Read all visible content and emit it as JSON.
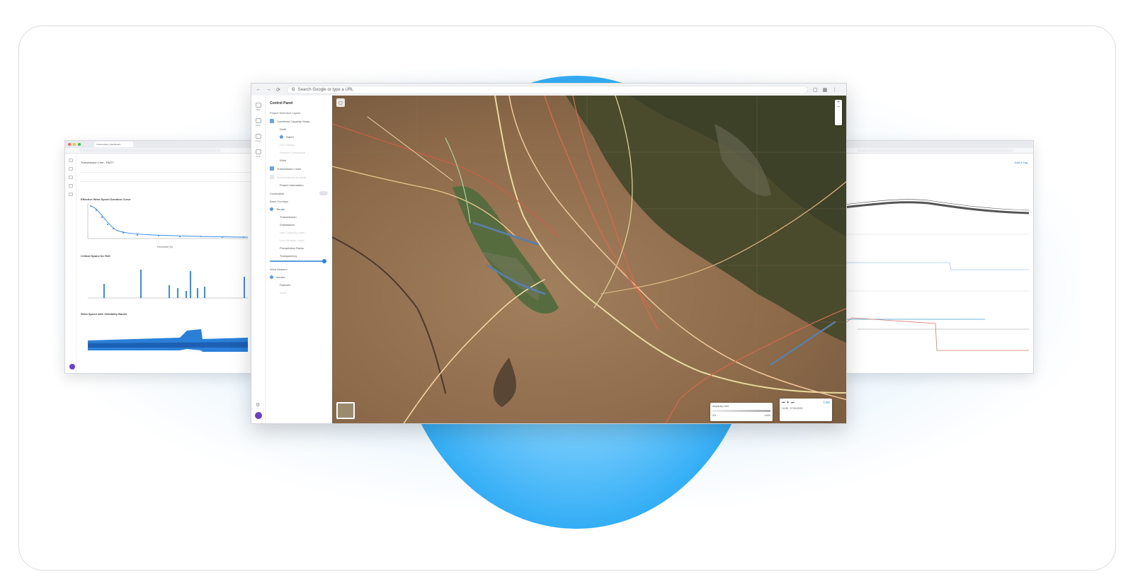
{
  "main_window": {
    "url_placeholder": "Search Google or type a URL",
    "nav": {
      "back": "←",
      "forward": "→",
      "reload": "⟳"
    },
    "control_panel": {
      "title": "Control Panel",
      "section_project_layers": "Project Selection Layers",
      "items": [
        {
          "label": "Combined Capacity Study",
          "kind": "checkbox",
          "checked": true
        },
        {
          "label": "Draft",
          "kind": "sub"
        },
        {
          "label": "Rated",
          "kind": "sub"
        },
        {
          "label": "Line Rating",
          "kind": "sub-faint"
        },
        {
          "label": "Sample Comparison",
          "kind": "sub-faint"
        },
        {
          "label": "Wind",
          "kind": "sub"
        },
        {
          "label": "Transmission Lines",
          "kind": "checkbox",
          "checked": true
        },
        {
          "label": "Environmental Analysis",
          "kind": "checkbox-faint"
        },
        {
          "label": "Project Information",
          "kind": "plain"
        }
      ],
      "toggle_label": "Constraints",
      "section_base_overlays": "Base Overlays",
      "overlays": [
        {
          "label": "Terrain",
          "kind": "radio"
        },
        {
          "label": "Transmission",
          "kind": "plain"
        },
        {
          "label": "Substations",
          "kind": "plain"
        },
        {
          "label": "Line Capacity Layer",
          "kind": "faint"
        },
        {
          "label": "Line Weather Layer",
          "kind": "faint"
        },
        {
          "label": "Precipitation Radar",
          "kind": "plain"
        }
      ],
      "slider_label": "Transparency",
      "slider_value": 0.9,
      "section_wind_markers": "Wind Markers",
      "wind": [
        {
          "label": "Arrows",
          "kind": "radio"
        },
        {
          "label": "Particles",
          "kind": "plain"
        },
        {
          "label": "None",
          "kind": "faint"
        }
      ]
    },
    "rail_captions": [
      "Map",
      "Data",
      "Layers",
      "Tools"
    ],
    "map_legend": {
      "title": "Ampacity Limit",
      "min": "0%",
      "max": "100%"
    },
    "time_control": {
      "label": "12:45 · 07/01/2025",
      "live": "Live"
    }
  },
  "left_window": {
    "tab": "Transmission_Dashboard",
    "heading": "Transmission Line - RM77",
    "chart1_title": "Effective Wind Speed Duration Curve",
    "chart1_xlabel": "Percentile (%)",
    "chart2_title": "Critical Spans for R49",
    "chart3_title": "Wind Speed with Variability Bands"
  },
  "right_window": {
    "link": "Add a Tag"
  },
  "colors": {
    "orb": "#29a9f5",
    "accent": "#2f7fd6",
    "avatar": "#6b3fc7"
  }
}
